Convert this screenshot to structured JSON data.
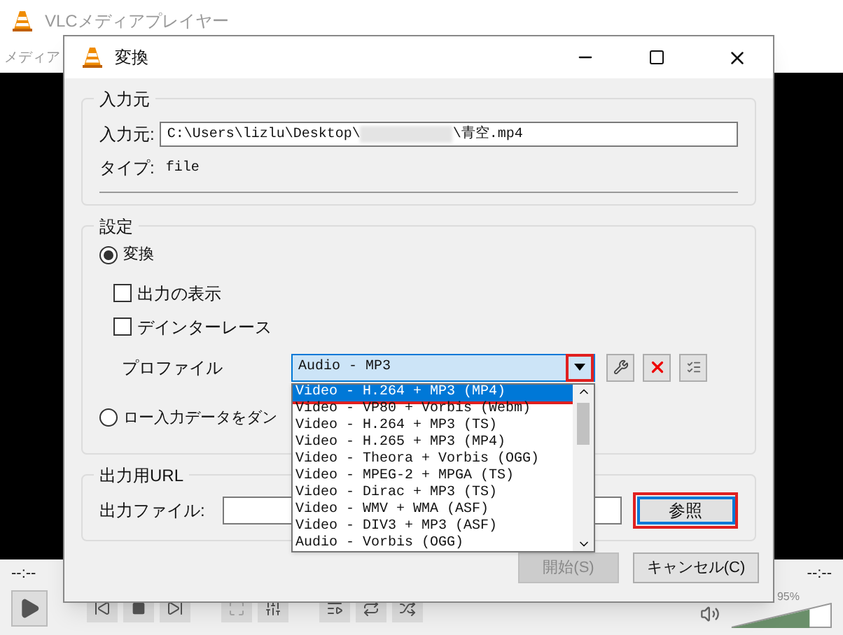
{
  "main_window": {
    "title": "VLCメディアプレイヤー",
    "menu": [
      "メディア"
    ],
    "time_left": "--:--",
    "time_right": "--:--",
    "volume": {
      "reading": "95%",
      "level": 0.78
    }
  },
  "dialog": {
    "title": "変換",
    "source": {
      "legend": "入力元",
      "label": "入力元:",
      "path_start": "C:\\Users\\lizlu\\Desktop\\",
      "path_end": "\\青空.mp4",
      "type_label": "タイプ:",
      "type_value": "file"
    },
    "settings": {
      "legend": "設定",
      "radios": [
        {
          "label": "変換",
          "selected": true
        },
        {
          "label": "ロー入力データをダン",
          "selected": false
        }
      ],
      "checkboxes": [
        {
          "label": "出力の表示",
          "checked": false
        },
        {
          "label": "デインターレース",
          "checked": false
        }
      ],
      "profile_label": "プロファイル",
      "profile_value": "Audio - MP3",
      "arrow_highlighted": true
    },
    "output": {
      "legend": "出力用URL",
      "label": "出力ファイル:",
      "browse": "参照",
      "browse_highlighted": true
    },
    "buttons": [
      {
        "label": "開始(S)",
        "disabled": true
      },
      {
        "label": "キャンセル(C)",
        "disabled": false
      }
    ]
  },
  "profile_list": [
    {
      "label": "Video - H.264 + MP3 (MP4)",
      "selected": true,
      "highlighted": true
    },
    {
      "label": "Video - VP80 + Vorbis (Webm)",
      "selected": false,
      "highlighted": false
    },
    {
      "label": "Video - H.264 + MP3 (TS)",
      "selected": false,
      "highlighted": false
    },
    {
      "label": "Video - H.265 + MP3 (MP4)",
      "selected": false,
      "highlighted": false
    },
    {
      "label": "Video - Theora + Vorbis (OGG)",
      "selected": false,
      "highlighted": false
    },
    {
      "label": "Video - MPEG-2 + MPGA (TS)",
      "selected": false,
      "highlighted": false
    },
    {
      "label": "Video - Dirac + MP3 (TS)",
      "selected": false,
      "highlighted": false
    },
    {
      "label": "Video - WMV + WMA (ASF)",
      "selected": false,
      "highlighted": false
    },
    {
      "label": "Video - DIV3 + MP3 (ASF)",
      "selected": false,
      "highlighted": false
    },
    {
      "label": "Audio - Vorbis (OGG)",
      "selected": false,
      "highlighted": false
    }
  ]
}
